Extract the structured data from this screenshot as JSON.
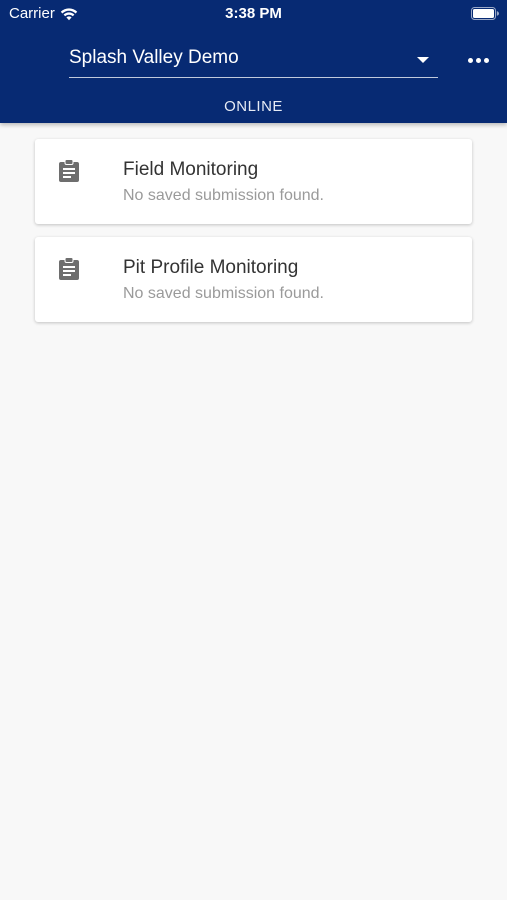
{
  "status_bar": {
    "carrier": "Carrier",
    "time": "3:38 PM",
    "wifi_icon": "wifi-icon",
    "battery_icon": "battery-icon"
  },
  "header": {
    "project_selected": "Splash Valley Demo",
    "dropdown_icon": "chevron-down-icon",
    "more_icon": "more-horizontal-icon",
    "connection_status": "ONLINE"
  },
  "forms": [
    {
      "title": "Field Monitoring",
      "subtitle": "No saved submission found.",
      "icon": "clipboard-icon"
    },
    {
      "title": "Pit Profile Monitoring",
      "subtitle": "No saved submission found.",
      "icon": "clipboard-icon"
    }
  ],
  "colors": {
    "header_bg": "#072a73",
    "page_bg": "#f8f8f8",
    "card_bg": "#ffffff",
    "title_text": "#333333",
    "subtitle_text": "#9a9a9a",
    "icon_gray": "#6e6e6e"
  }
}
